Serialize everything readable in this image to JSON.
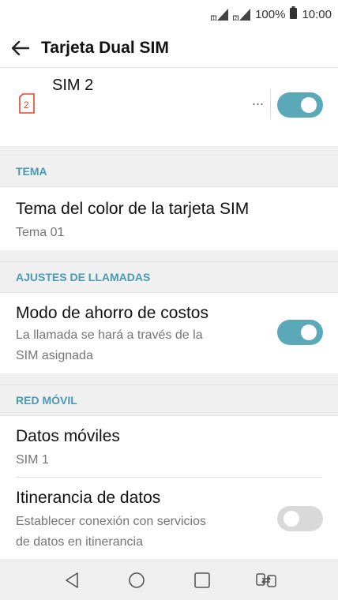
{
  "status_bar": {
    "battery_percent": "100%",
    "time": "10:00",
    "icons": [
      "sim-1-signal-icon",
      "sim-2-signal-icon",
      "battery-icon"
    ]
  },
  "app_bar": {
    "title": "Tarjeta Dual SIM",
    "back_icon": "back-arrow-icon"
  },
  "sim2": {
    "label": "SIM 2",
    "icon_text": "2",
    "enabled": true
  },
  "sections": {
    "tema": {
      "header": "TEMA",
      "items": [
        {
          "title": "Tema del color de la tarjeta SIM",
          "subtitle": "Tema 01"
        }
      ]
    },
    "ajustes": {
      "header": "AJUSTES DE LLAMADAS",
      "items": [
        {
          "title": "Modo de ahorro de costos",
          "subtitle_line1": "La llamada se hará a través de la",
          "subtitle_line2": "SIM asignada",
          "toggle_on": true
        }
      ]
    },
    "red": {
      "header": "RED MÓVIL",
      "items": [
        {
          "title": "Datos móviles",
          "subtitle": "SIM 1"
        },
        {
          "title": "Itinerancia de datos",
          "subtitle_line1": "Establecer conexión con servicios",
          "subtitle_line2": "de datos en itinerancia",
          "toggle_on": false
        }
      ]
    }
  },
  "nav_bar": {
    "buttons": [
      "back-triangle-icon",
      "home-circle-icon",
      "recents-square-icon",
      "dual-window-icon"
    ]
  },
  "colors": {
    "accent": "#5aa8b8",
    "section_header": "#4a9ab2",
    "sim_icon": "#e0452c"
  }
}
